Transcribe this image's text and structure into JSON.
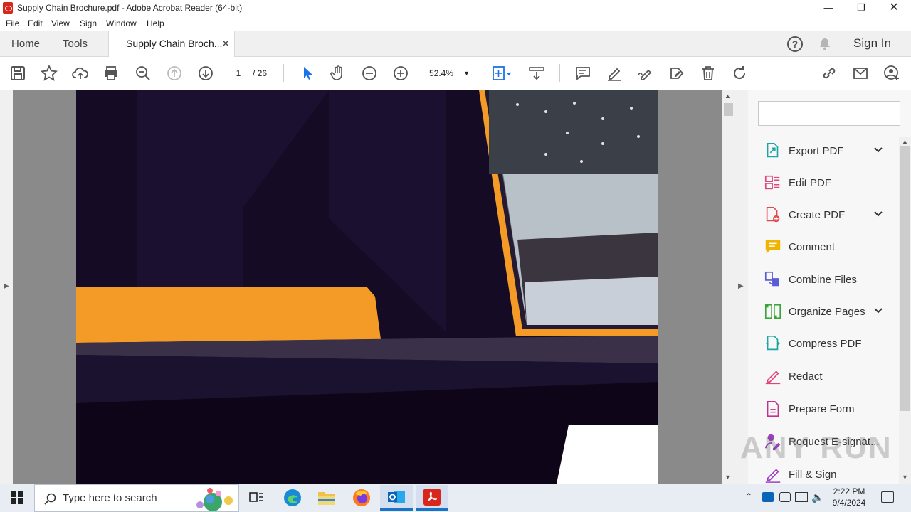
{
  "window": {
    "title": "Supply Chain Brochure.pdf - Adobe Acrobat Reader (64-bit)"
  },
  "menu": [
    "File",
    "Edit",
    "View",
    "Sign",
    "Window",
    "Help"
  ],
  "tabs": {
    "home": "Home",
    "tools": "Tools",
    "doc": "Supply Chain Broch...",
    "sign_in": "Sign In"
  },
  "toolbar": {
    "page_current": "1",
    "page_total": "/ 26",
    "zoom": "52.4%"
  },
  "right_pane": {
    "tools": [
      {
        "label": "Export PDF",
        "icon": "export-pdf-icon",
        "color": "#1aa6a6",
        "chevron": true
      },
      {
        "label": "Edit PDF",
        "icon": "edit-pdf-icon",
        "color": "#e0457b",
        "chevron": false
      },
      {
        "label": "Create PDF",
        "icon": "create-pdf-icon",
        "color": "#e34850",
        "chevron": true
      },
      {
        "label": "Comment",
        "icon": "comment-icon",
        "color": "#f0b400",
        "chevron": false
      },
      {
        "label": "Combine Files",
        "icon": "combine-files-icon",
        "color": "#5b5bd6",
        "chevron": false
      },
      {
        "label": "Organize Pages",
        "icon": "organize-pages-icon",
        "color": "#3aa33a",
        "chevron": true
      },
      {
        "label": "Compress PDF",
        "icon": "compress-pdf-icon",
        "color": "#1aa6a6",
        "chevron": false
      },
      {
        "label": "Redact",
        "icon": "redact-icon",
        "color": "#e0457b",
        "chevron": false
      },
      {
        "label": "Prepare Form",
        "icon": "prepare-form-icon",
        "color": "#c4318f",
        "chevron": false
      },
      {
        "label": "Request E-signat...",
        "icon": "request-esign-icon",
        "color": "#9b3fc4",
        "chevron": false
      },
      {
        "label": "Fill & Sign",
        "icon": "fill-sign-icon",
        "color": "#9b3fc4",
        "chevron": false
      }
    ]
  },
  "taskbar": {
    "search_placeholder": "Type here to search",
    "time": "2:22 PM",
    "date": "9/4/2024"
  },
  "watermark": "ANY RUN",
  "colors": {
    "accent_orange": "#f39a27",
    "pdf_bg": "#150a24"
  }
}
